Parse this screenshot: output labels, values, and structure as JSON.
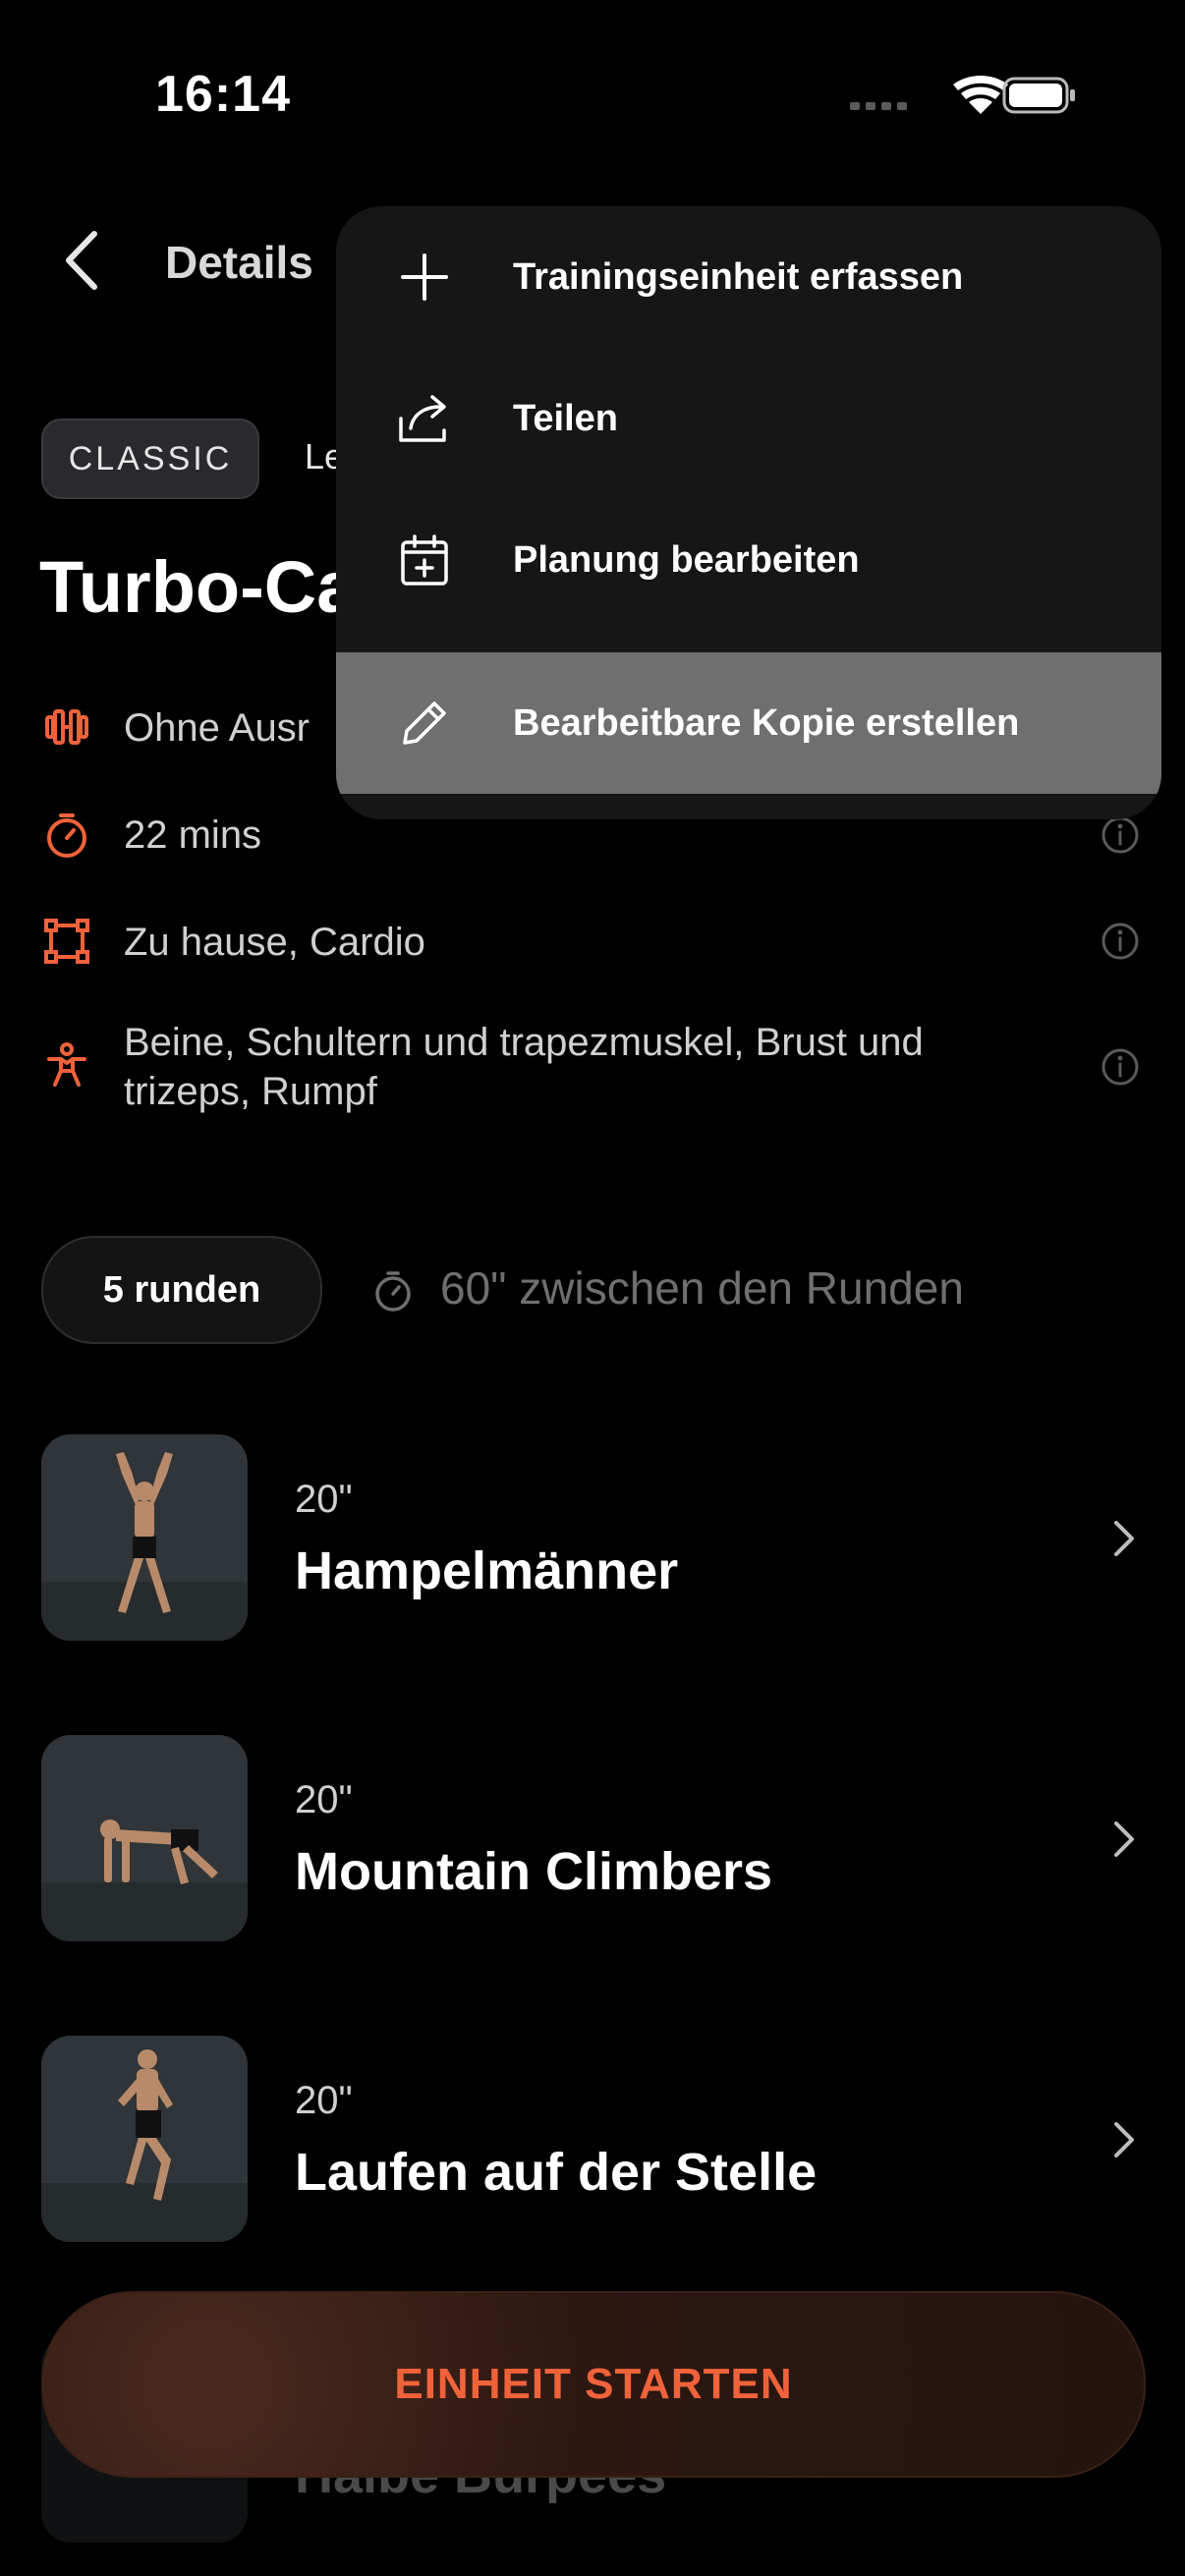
{
  "status_bar": {
    "time": "16:14"
  },
  "header": {
    "title": "Details"
  },
  "tags": {
    "classic": "CLASSIC",
    "level_partial": "Le"
  },
  "workout": {
    "title_partial": "Turbo-Ca"
  },
  "info_rows": [
    {
      "icon": "dumbbell-icon",
      "text": "Ohne Ausr"
    },
    {
      "icon": "stopwatch-icon",
      "text": "22 mins"
    },
    {
      "icon": "frame-icon",
      "text": "Zu hause, Cardio"
    },
    {
      "icon": "body-icon",
      "text_line1": "Beine, Schultern und trapezmuskel, Brust und",
      "text_line2": "trizeps, Rumpf"
    }
  ],
  "rounds": {
    "label": "5 runden",
    "rest": "60\" zwischen den Runden"
  },
  "exercises": [
    {
      "duration": "20\"",
      "name": "Hampelmänner"
    },
    {
      "duration": "20\"",
      "name": "Mountain Climbers"
    },
    {
      "duration": "20\"",
      "name": "Laufen auf der Stelle"
    },
    {
      "name": "Halbe Burpees"
    }
  ],
  "menu": {
    "items": [
      {
        "icon": "plus-icon",
        "label": "Trainingseinheit erfassen"
      },
      {
        "icon": "share-icon",
        "label": "Teilen"
      },
      {
        "icon": "calendar-add-icon",
        "label": "Planung bearbeiten"
      },
      {
        "icon": "pencil-icon",
        "label": "Bearbeitbare Kopie erstellen",
        "highlighted": true
      }
    ]
  },
  "cta": {
    "label": "EINHEIT STARTEN"
  },
  "colors": {
    "accent": "#f0623a",
    "background": "#000000",
    "menu_bg": "#161616",
    "menu_highlight": "#6f6f6f"
  }
}
